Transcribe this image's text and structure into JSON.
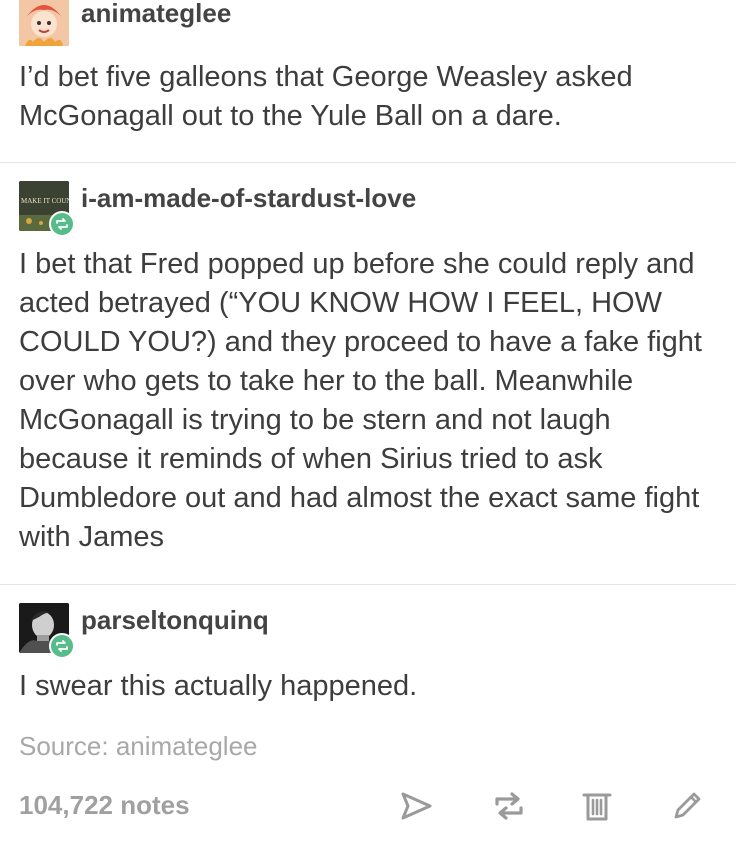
{
  "posts": [
    {
      "username": "animateglee",
      "body": "I’d bet five galleons that George Weasley asked McGonagall out to the Yule Ball on a dare."
    },
    {
      "username": "i-am-made-of-stardust-love",
      "avatar_text": "MAKE IT COUNT",
      "body": "I bet that Fred popped up before she could reply and acted betrayed (“YOU KNOW HOW I FEEL, HOW COULD YOU?) and they proceed to have a fake fight over who gets to take her to the ball. Meanwhile McGonagall is trying to be stern and not laugh because it reminds of when Sirius tried to ask Dumbledore out and had almost the exact same fight with James"
    },
    {
      "username": "parseltonquinq",
      "body": "I swear this actually happened."
    }
  ],
  "source": {
    "label": "Source: ",
    "name": "animateglee"
  },
  "footer": {
    "notes": "104,722 notes"
  },
  "icons": {
    "share": "share-icon",
    "reblog": "reblog-icon",
    "delete": "trash-icon",
    "edit": "pencil-icon"
  },
  "colors": {
    "reblog_badge": "#56bc8a",
    "body_text": "#3d3d3d",
    "muted": "#a8a8a8",
    "icon": "#9a9a9a"
  }
}
